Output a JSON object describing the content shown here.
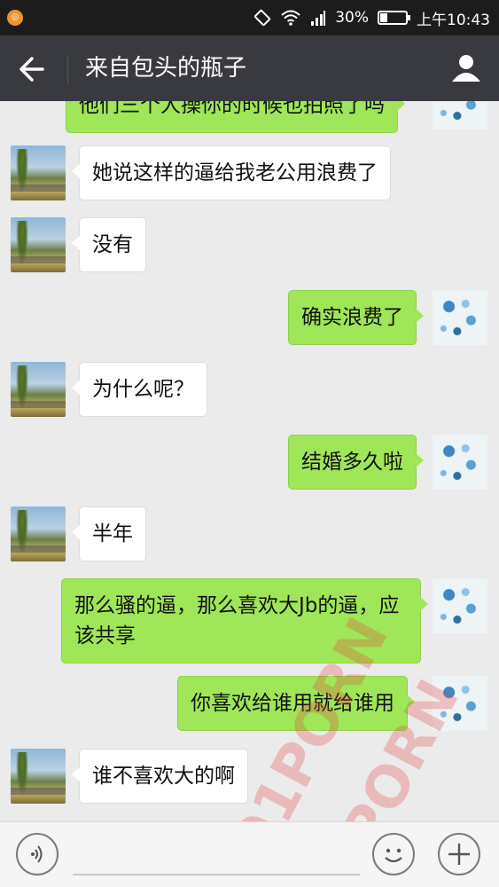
{
  "status_bar": {
    "battery": "30%",
    "time": "上午10:43",
    "battery_level": 0.3
  },
  "header": {
    "title": "来自包头的瓶子"
  },
  "messages": [
    {
      "side": "right",
      "text": "他们三个人操你的时候也拍照了吗"
    },
    {
      "side": "left",
      "text": "她说这样的逼给我老公用浪费了"
    },
    {
      "side": "left",
      "text": "没有"
    },
    {
      "side": "right",
      "text": "确实浪费了"
    },
    {
      "side": "left",
      "text": "为什么呢？"
    },
    {
      "side": "right",
      "text": "结婚多久啦"
    },
    {
      "side": "left",
      "text": "半年"
    },
    {
      "side": "right",
      "text": "那么骚的逼，那么喜欢大Jb的逼，应该共享"
    },
    {
      "side": "right",
      "text": "你喜欢给谁用就给谁用"
    },
    {
      "side": "left",
      "text": "谁不喜欢大的啊"
    }
  ],
  "watermark": {
    "text": "91PORN"
  },
  "icons": {
    "back": "arrow-left-icon",
    "profile": "person-icon",
    "voice": "voice-icon",
    "emoji": "emoji-icon",
    "plus": "plus-icon"
  }
}
